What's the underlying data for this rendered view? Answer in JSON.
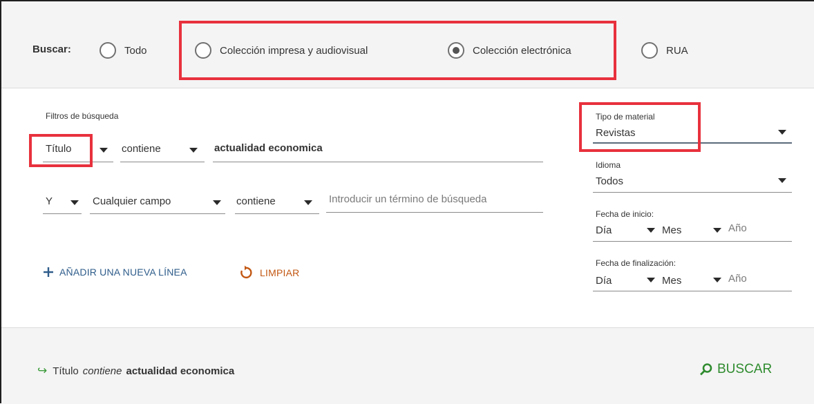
{
  "search_scope": {
    "label": "Buscar:",
    "options": [
      {
        "label": "Todo",
        "checked": false
      },
      {
        "label": "Colección impresa y audiovisual",
        "checked": false
      },
      {
        "label": "Colección electrónica",
        "checked": true
      },
      {
        "label": "RUA",
        "checked": false
      }
    ]
  },
  "filters": {
    "heading": "Filtros de búsqueda",
    "row1": {
      "field": "Título",
      "operator": "contiene",
      "value": "actualidad economica"
    },
    "row2": {
      "boolean": "Y",
      "field": "Cualquier campo",
      "operator": "contiene",
      "placeholder": "Introducir un término de búsqueda"
    },
    "add_line": "AÑADIR UNA NUEVA LÍNEA",
    "clear": "LIMPIAR"
  },
  "facets": {
    "material": {
      "label": "Tipo de material",
      "value": "Revistas"
    },
    "language": {
      "label": "Idioma",
      "value": "Todos"
    },
    "start_date": {
      "label": "Fecha de inicio:",
      "day": "Día",
      "month": "Mes",
      "year": "Año"
    },
    "end_date": {
      "label": "Fecha de finalización:",
      "day": "Día",
      "month": "Mes",
      "year": "Año"
    }
  },
  "summary": {
    "field": "Título",
    "operator": "contiene",
    "value": "actualidad economica"
  },
  "search_button": "BUSCAR",
  "colors": {
    "highlight": "#e8313d",
    "add_link": "#2e5c8a",
    "clear_link": "#c25712",
    "search": "#2e8b2e"
  }
}
